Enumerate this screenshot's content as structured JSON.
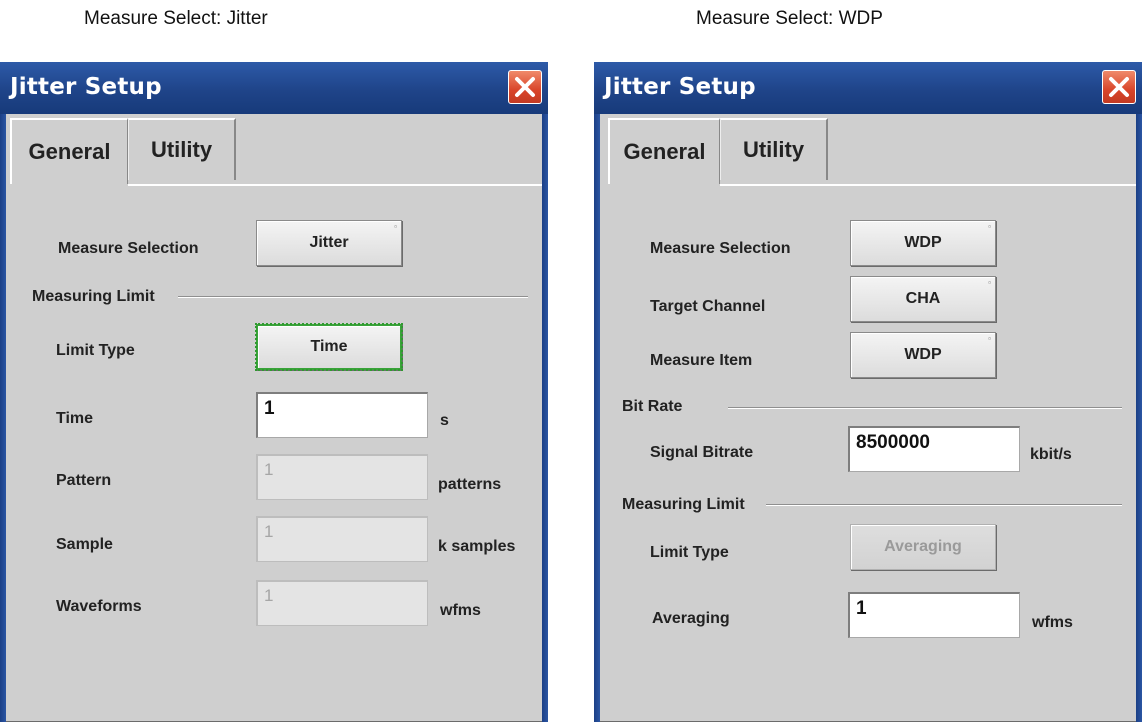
{
  "captions": {
    "left": "Measure Select: Jitter",
    "right": "Measure Select: WDP"
  },
  "colors": {
    "titlebar": "#1f4489",
    "close_button": "#d9452a",
    "dialog_bg": "#cfcfcf",
    "focus": "#3aa33a"
  },
  "left_dialog": {
    "title": "Jitter Setup",
    "tabs": [
      {
        "label": "General",
        "active": true
      },
      {
        "label": "Utility",
        "active": false
      }
    ],
    "measure_selection": {
      "label": "Measure Selection",
      "value": "Jitter"
    },
    "measuring_limit_group": "Measuring Limit",
    "limit_type": {
      "label": "Limit Type",
      "value": "Time"
    },
    "time": {
      "label": "Time",
      "value": "1",
      "unit": "s"
    },
    "pattern": {
      "label": "Pattern",
      "value": "1",
      "unit": "patterns"
    },
    "sample": {
      "label": "Sample",
      "value": "1",
      "unit": "k samples"
    },
    "waveforms": {
      "label": "Waveforms",
      "value": "1",
      "unit": "wfms"
    }
  },
  "right_dialog": {
    "title": "Jitter Setup",
    "tabs": [
      {
        "label": "General",
        "active": true
      },
      {
        "label": "Utility",
        "active": false
      }
    ],
    "measure_selection": {
      "label": "Measure Selection",
      "value": "WDP"
    },
    "target_channel": {
      "label": "Target Channel",
      "value": "CHA"
    },
    "measure_item": {
      "label": "Measure Item",
      "value": "WDP"
    },
    "bit_rate_group": "Bit Rate",
    "signal_bitrate": {
      "label": "Signal Bitrate",
      "value": "8500000",
      "unit": "kbit/s"
    },
    "measuring_limit_group": "Measuring Limit",
    "limit_type": {
      "label": "Limit Type",
      "value": "Averaging"
    },
    "averaging": {
      "label": "Averaging",
      "value": "1",
      "unit": "wfms"
    }
  }
}
